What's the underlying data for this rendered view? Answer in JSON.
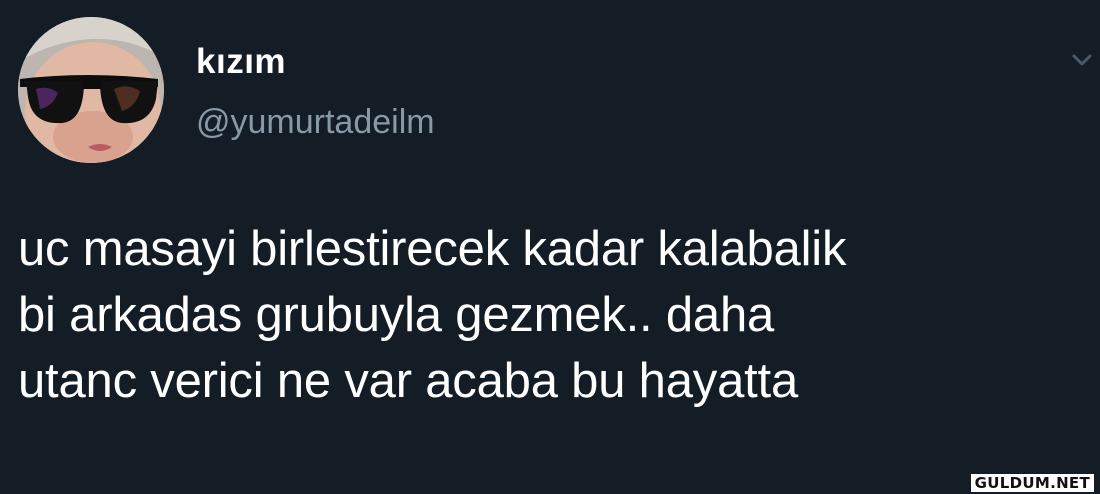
{
  "tweet": {
    "display_name": "kızım",
    "handle": "@yumurtadeilm",
    "text": "uc masayi birlestirecek kadar kalabalik\nbi arkadas grubuyla gezmek.. daha\nutanc verici ne var acaba bu hayatta",
    "avatar_icon": "profile-photo",
    "menu_icon": "chevron-down-icon"
  },
  "watermark": "GULDUM.NET",
  "colors": {
    "background": "#141d26",
    "handle": "#8899a6",
    "text": "#ffffff"
  }
}
